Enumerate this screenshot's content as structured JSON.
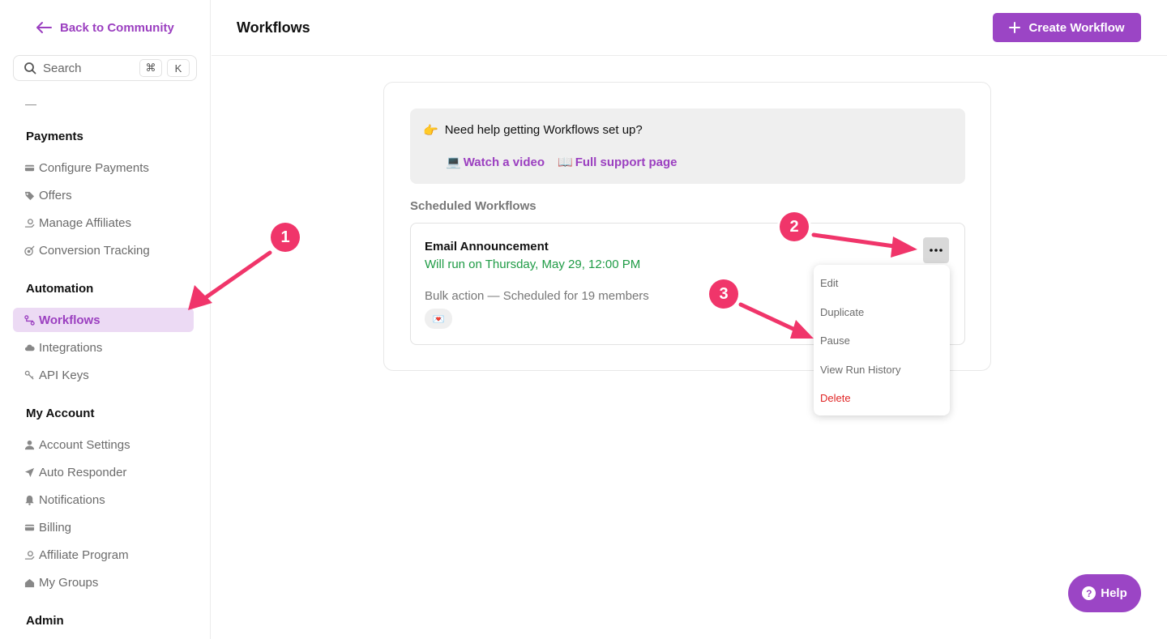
{
  "sidebar": {
    "back_label": "Back to Community",
    "search": {
      "placeholder": "Search",
      "kbd_cmd": "⌘",
      "kbd_key": "K"
    },
    "dash": "—",
    "sections": {
      "payments": {
        "title": "Payments",
        "items": [
          "Configure Payments",
          "Offers",
          "Manage Affiliates",
          "Conversion Tracking"
        ]
      },
      "automation": {
        "title": "Automation",
        "items": [
          "Workflows",
          "Integrations",
          "API Keys"
        ]
      },
      "my_account": {
        "title": "My Account",
        "items": [
          "Account Settings",
          "Auto Responder",
          "Notifications",
          "Billing",
          "Affiliate Program",
          "My Groups"
        ]
      },
      "admin": {
        "title": "Admin"
      }
    },
    "active_item": "Workflows"
  },
  "header": {
    "title": "Workflows",
    "create_label": "Create Workflow"
  },
  "help_box": {
    "pointer_emoji": "👉",
    "question": "Need help getting Workflows set up?",
    "video_emoji": "💻",
    "video_label": "Watch a video",
    "support_emoji": "📖",
    "support_label": "Full support page"
  },
  "scheduled": {
    "label": "Scheduled Workflows",
    "item": {
      "name": "Email Announcement",
      "when": "Will run on Thursday, May 29, 12:00 PM",
      "bulk": "Bulk action — Scheduled for 19 members",
      "badge_emoji": "💌"
    }
  },
  "menu": {
    "items": [
      "Edit",
      "Duplicate",
      "Pause",
      "View Run History",
      "Delete"
    ]
  },
  "help_fab": {
    "label": "Help",
    "icon": "?"
  },
  "annotations": {
    "steps": [
      "1",
      "2",
      "3"
    ]
  },
  "colors": {
    "accent": "#9b45c5",
    "accent_text": "#9b3fc0",
    "active_bg": "#ecdaf4",
    "success": "#1e9b45",
    "danger": "#e02424",
    "annotation": "#f0356a"
  }
}
